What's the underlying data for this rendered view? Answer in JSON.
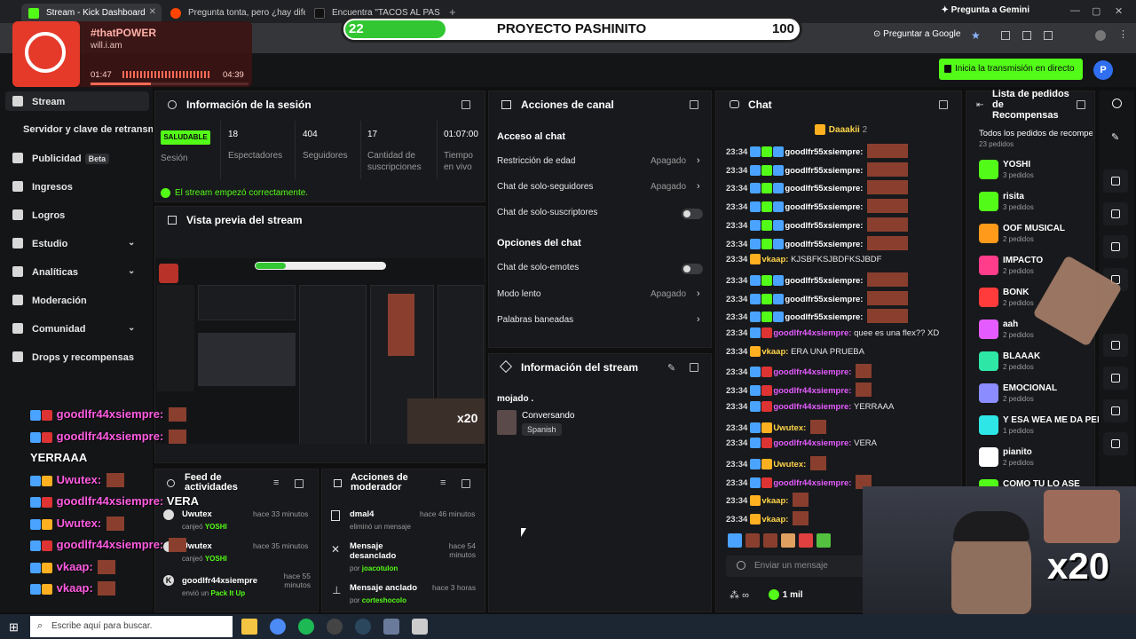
{
  "browser": {
    "tabs": [
      {
        "title": "Stream - Kick Dashboard",
        "active": true
      },
      {
        "title": "Pregunta tonta, pero ¿hay dife"
      },
      {
        "title": "Encuentra \"TACOS AL PASTOR\""
      }
    ],
    "gemini": "Pregunta a Gemini",
    "omnibox_action": "Preguntar a Google"
  },
  "overlay": {
    "progress_value": "22",
    "progress_title": "PROYECTO PASHINITO",
    "progress_goal": "100",
    "progress_fraction": 0.22,
    "music": {
      "hashtag": "#thatPOWER",
      "artist": "will.i.am",
      "elapsed": "01:47",
      "total": "04:39",
      "progress": 0.38
    },
    "cam_badge": "x20"
  },
  "header": {
    "go_live": "Inicia la transmisión en directo",
    "avatar": "P"
  },
  "sidebar": {
    "items": [
      {
        "label": "Stream",
        "icon": "stream-icon",
        "active": true
      },
      {
        "label": "Servidor y clave de retransmisión"
      },
      {
        "label": "Publicidad",
        "icon": "ads-icon",
        "badge": "Beta"
      },
      {
        "label": "Ingresos",
        "icon": "revenue-icon"
      },
      {
        "label": "Logros",
        "icon": "trophy-icon"
      },
      {
        "label": "Estudio",
        "icon": "studio-icon",
        "chevron": true
      },
      {
        "label": "Analíticas",
        "icon": "analytics-icon",
        "chevron": true
      },
      {
        "label": "Moderación",
        "icon": "moderation-icon"
      },
      {
        "label": "Comunidad",
        "icon": "community-icon",
        "chevron": true
      },
      {
        "label": "Drops y recompensas",
        "icon": "gift-icon"
      }
    ]
  },
  "session": {
    "title": "Información de la sesión",
    "status": "SALUDABLE",
    "status_label": "Sesión",
    "stats": [
      {
        "value": "18",
        "label": "Espectadores"
      },
      {
        "value": "404",
        "label": "Seguidores"
      },
      {
        "value": "17",
        "label": "Cantidad de suscripciones"
      },
      {
        "value": "01:07:00",
        "label": "Tiempo en vivo"
      }
    ],
    "ok_message": "El stream empezó correctamente."
  },
  "preview": {
    "title": "Vista previa del stream"
  },
  "channel_actions": {
    "title": "Acciones de canal",
    "section1": "Acceso al chat",
    "section2": "Opciones del chat",
    "rows": [
      {
        "label": "Restricción de edad",
        "value": "Apagado",
        "chevron": true
      },
      {
        "label": "Chat de solo-seguidores",
        "value": "Apagado",
        "chevron": true
      },
      {
        "label": "Chat de solo-suscriptores",
        "toggle": true
      },
      {
        "label": "Chat de solo-emotes",
        "toggle": true
      },
      {
        "label": "Modo lento",
        "value": "Apagado",
        "chevron": true
      },
      {
        "label": "Palabras baneadas",
        "chevron": true
      }
    ]
  },
  "stream_info": {
    "title": "Información del stream",
    "stream_title": "mojado .",
    "category": "Conversando",
    "language": "Spanish"
  },
  "activity": {
    "title": "Feed de actividades",
    "items": [
      {
        "user": "Uwutex",
        "action": "canjeó",
        "reward": "YOSHI",
        "time": "hace 33 minutos"
      },
      {
        "user": "Uwutex",
        "action": "canjeó",
        "reward": "YOSHI",
        "time": "hace 35 minutos"
      },
      {
        "user": "goodlfr44xsiempre",
        "action": "envió un",
        "reward": "Pack It Up",
        "time": "hace 55 minutos"
      }
    ]
  },
  "mod_actions": {
    "title": "Acciones de moderador",
    "items": [
      {
        "title": "dmal4",
        "sub": "eliminó un mensaje",
        "by": "",
        "time": "hace 46 minutos"
      },
      {
        "title": "Mensaje desanclado",
        "sub": "por",
        "by": "joacotulon",
        "time": "hace 54 minutos"
      },
      {
        "title": "Mensaje anclado",
        "sub": "por",
        "by": "corteshocolo",
        "time": "hace 3 horas"
      }
    ]
  },
  "chat": {
    "title": "Chat",
    "pinned_user": "Daaakii",
    "pinned_count": "2",
    "messages": [
      {
        "time": "23:34",
        "user": "goodlfr55xsiempre:",
        "text": "",
        "emote": true,
        "color": "#ffffff"
      },
      {
        "time": "23:34",
        "user": "goodlfr55xsiempre:",
        "text": "",
        "emote": true,
        "color": "#ffffff"
      },
      {
        "time": "23:34",
        "user": "goodlfr55xsiempre:",
        "text": "",
        "emote": true,
        "color": "#ffffff"
      },
      {
        "time": "23:34",
        "user": "goodlfr55xsiempre:",
        "text": "",
        "emote": true,
        "color": "#ffffff"
      },
      {
        "time": "23:34",
        "user": "goodlfr55xsiempre:",
        "text": "",
        "emote": true,
        "color": "#ffffff"
      },
      {
        "time": "23:34",
        "user": "goodlfr55xsiempre:",
        "text": "",
        "emote": true,
        "color": "#ffffff"
      },
      {
        "time": "23:34",
        "user": "vkaap:",
        "text": "KJSBFKSJBDFKSJBDF",
        "emote": false,
        "color": "#ffd54a"
      },
      {
        "time": "23:34",
        "user": "goodlfr55xsiempre:",
        "text": "",
        "emote": true,
        "color": "#ffffff"
      },
      {
        "time": "23:34",
        "user": "goodlfr55xsiempre:",
        "text": "",
        "emote": true,
        "color": "#ffffff"
      },
      {
        "time": "23:34",
        "user": "goodlfr55xsiempre:",
        "text": "",
        "emote": true,
        "color": "#ffffff"
      },
      {
        "time": "23:34",
        "user": "goodlfr44xsiempre:",
        "text": "quee es una flex?? XD",
        "emote": false,
        "color": "#e45cff"
      },
      {
        "time": "23:34",
        "user": "vkaap:",
        "text": "ERA UNA PRUEBA",
        "emote": false,
        "color": "#ffd54a"
      },
      {
        "time": "23:34",
        "user": "goodlfr44xsiempre:",
        "text": "",
        "emote": true,
        "color": "#e45cff"
      },
      {
        "time": "23:34",
        "user": "goodlfr44xsiempre:",
        "text": "",
        "emote": true,
        "color": "#e45cff"
      },
      {
        "time": "23:34",
        "user": "goodlfr44xsiempre:",
        "text": "YERRAAA",
        "emote": false,
        "color": "#e45cff"
      },
      {
        "time": "23:34",
        "user": "Uwutex:",
        "text": "",
        "emote": true,
        "color": "#ffd54a"
      },
      {
        "time": "23:34",
        "user": "goodlfr44xsiempre:",
        "text": "VERA",
        "emote": false,
        "color": "#e45cff"
      },
      {
        "time": "23:34",
        "user": "Uwutex:",
        "text": "",
        "emote": true,
        "color": "#ffd54a"
      },
      {
        "time": "23:34",
        "user": "goodlfr44xsiempre:",
        "text": "",
        "emote": true,
        "color": "#e45cff"
      },
      {
        "time": "23:34",
        "user": "vkaap:",
        "text": "",
        "emote": true,
        "color": "#ffd54a"
      },
      {
        "time": "23:34",
        "user": "vkaap:",
        "text": "",
        "emote": true,
        "color": "#ffd54a"
      }
    ],
    "input_placeholder": "Enviar un mensaje",
    "viewers_symbol": "∞",
    "points": "1 mil"
  },
  "rewards": {
    "title": "Lista de pedidos de Recompensas",
    "subtitle": "Todos los pedidos de recompensas",
    "count": "23 pedidos",
    "items": [
      {
        "name": "YOSHI",
        "count": "3 pedidos",
        "color": "#53fc18"
      },
      {
        "name": "risita",
        "count": "3 pedidos",
        "color": "#53fc18"
      },
      {
        "name": "OOF MUSICAL",
        "count": "2 pedidos",
        "color": "#ff9a1a"
      },
      {
        "name": "IMPACTO",
        "count": "2 pedidos",
        "color": "#ff3d8b"
      },
      {
        "name": "BONK",
        "count": "2 pedidos",
        "color": "#ff3b3b"
      },
      {
        "name": "aah",
        "count": "2 pedidos",
        "color": "#e45cff"
      },
      {
        "name": "BLAAAK",
        "count": "2 pedidos",
        "color": "#2ee6a6"
      },
      {
        "name": "EMOCIONAL",
        "count": "2 pedidos",
        "color": "#8a8cff"
      },
      {
        "name": "Y ESA WEA ME DA PENA",
        "count": "1 pedidos",
        "color": "#2ee6e6"
      },
      {
        "name": "pianito",
        "count": "2 pedidos",
        "color": "#ffffff"
      },
      {
        "name": "COMO TU LO ASE",
        "count": "",
        "color": "#53fc18"
      }
    ]
  },
  "overlay_chat": [
    {
      "user": "goodlfr44xsiempre:",
      "text": "",
      "cls": ""
    },
    {
      "user": "goodlfr44xsiempre:",
      "text": "",
      "cls": ""
    },
    {
      "user": "",
      "text": "YERRAAA",
      "cls": "w"
    },
    {
      "user": "Uwutex:",
      "text": "",
      "cls": "y"
    },
    {
      "user": "goodlfr44xsiempre:",
      "text": "VERA",
      "cls": ""
    },
    {
      "user": "Uwutex:",
      "text": "",
      "cls": "y"
    },
    {
      "user": "goodlfr44xsiempre:",
      "text": "",
      "cls": ""
    },
    {
      "user": "vkaap:",
      "text": "",
      "cls": "y"
    },
    {
      "user": "vkaap:",
      "text": "",
      "cls": "y"
    }
  ],
  "taskbar": {
    "search": "Escribe aquí para buscar."
  }
}
